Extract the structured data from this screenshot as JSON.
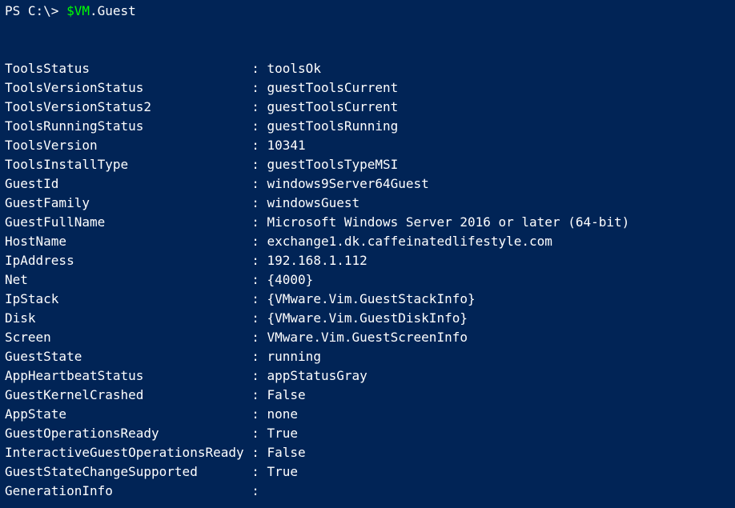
{
  "prompt": {
    "prefix": "PS C:\\> ",
    "var": "$VM",
    "member": ".Guest"
  },
  "rows": [
    {
      "key": "ToolsStatus",
      "value": "toolsOk"
    },
    {
      "key": "ToolsVersionStatus",
      "value": "guestToolsCurrent"
    },
    {
      "key": "ToolsVersionStatus2",
      "value": "guestToolsCurrent"
    },
    {
      "key": "ToolsRunningStatus",
      "value": "guestToolsRunning"
    },
    {
      "key": "ToolsVersion",
      "value": "10341"
    },
    {
      "key": "ToolsInstallType",
      "value": "guestToolsTypeMSI"
    },
    {
      "key": "GuestId",
      "value": "windows9Server64Guest"
    },
    {
      "key": "GuestFamily",
      "value": "windowsGuest"
    },
    {
      "key": "GuestFullName",
      "value": "Microsoft Windows Server 2016 or later (64-bit)"
    },
    {
      "key": "HostName",
      "value": "exchange1.dk.caffeinatedlifestyle.com"
    },
    {
      "key": "IpAddress",
      "value": "192.168.1.112"
    },
    {
      "key": "Net",
      "value": "{4000}"
    },
    {
      "key": "IpStack",
      "value": "{VMware.Vim.GuestStackInfo}"
    },
    {
      "key": "Disk",
      "value": "{VMware.Vim.GuestDiskInfo}"
    },
    {
      "key": "Screen",
      "value": "VMware.Vim.GuestScreenInfo"
    },
    {
      "key": "GuestState",
      "value": "running"
    },
    {
      "key": "AppHeartbeatStatus",
      "value": "appStatusGray"
    },
    {
      "key": "GuestKernelCrashed",
      "value": "False"
    },
    {
      "key": "AppState",
      "value": "none"
    },
    {
      "key": "GuestOperationsReady",
      "value": "True"
    },
    {
      "key": "InteractiveGuestOperationsReady",
      "value": "False"
    },
    {
      "key": "GuestStateChangeSupported",
      "value": "True"
    },
    {
      "key": "GenerationInfo",
      "value": ""
    }
  ]
}
